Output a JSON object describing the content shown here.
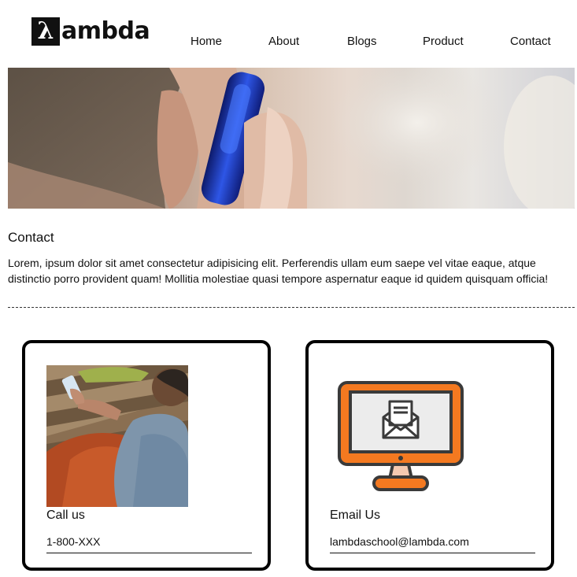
{
  "brand": {
    "logo_mark": "λ",
    "logo_text": "ambda"
  },
  "nav": {
    "items": [
      {
        "label": "Home"
      },
      {
        "label": "About"
      },
      {
        "label": "Blogs"
      },
      {
        "label": "Product"
      },
      {
        "label": "Contact"
      }
    ]
  },
  "hero": {
    "image": "hero-phone-call-photo"
  },
  "contact": {
    "title": "Contact",
    "body": "Lorem, ipsum dolor sit amet consectetur adipisicing elit. Perferendis ullam eum saepe vel vitae eaque, atque distinctio porro provident quam! Mollitia molestiae quasi tempore aspernatur eaque id quidem quisquam officia!"
  },
  "cards": {
    "call": {
      "title": "Call us",
      "value": "1-800-XXX",
      "image": "person-using-phone-photo"
    },
    "email": {
      "title": "Email Us",
      "value": "lambdaschool@lambda.com",
      "image": "monitor-envelope-icon"
    }
  },
  "colors": {
    "accent_orange": "#F47920",
    "dark": "#3a3a3a",
    "text": "#111111"
  }
}
